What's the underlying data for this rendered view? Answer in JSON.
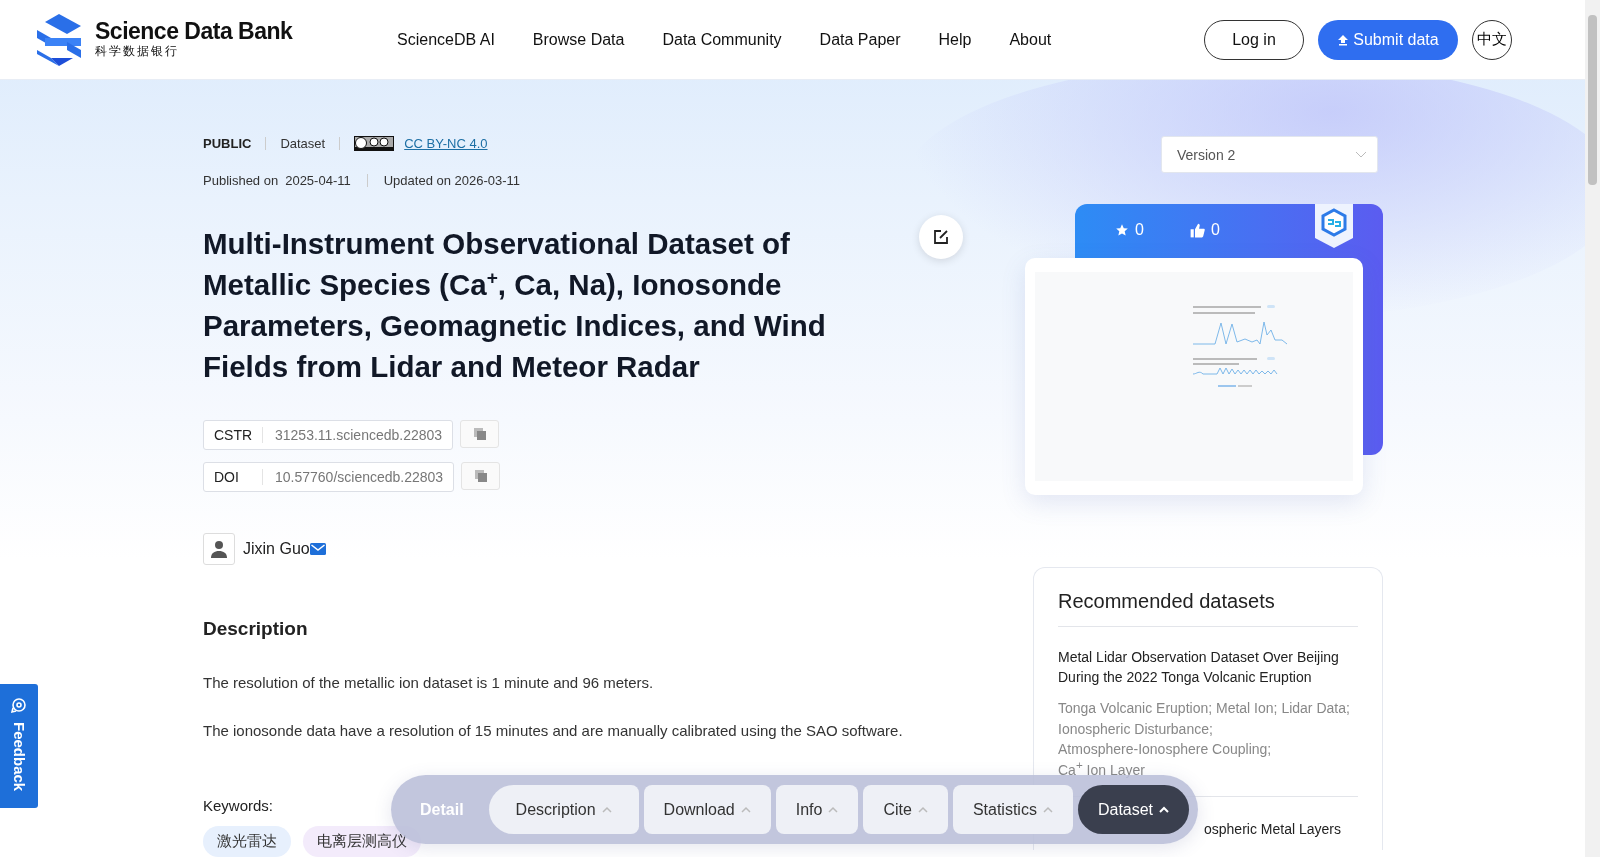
{
  "header": {
    "logo": {
      "title": "Science Data Bank",
      "subtitle": "科学数据银行"
    },
    "nav": [
      "ScienceDB AI",
      "Browse Data",
      "Data Community",
      "Data Paper",
      "Help",
      "About"
    ],
    "login": "Log in",
    "submit": "Submit data",
    "language": "中文"
  },
  "meta": {
    "access": "PUBLIC",
    "type": "Dataset",
    "license": "CC BY-NC 4.0",
    "published_label": "Published on",
    "published": "2025-04-11",
    "updated": "Updated on 2026-03-11"
  },
  "title": "Multi-Instrument Observational Dataset of Metallic Species (Ca$^{+}$, Ca, Na), Ionosonde Parameters, Geomagnetic Indices, and Wind Fields from Lidar and Meteor Radar",
  "identifiers": [
    {
      "label": "CSTR",
      "value": "31253.11.sciencedb.22803"
    },
    {
      "label": "DOI",
      "value": "10.57760/sciencedb.22803"
    }
  ],
  "author": {
    "name": "Jixin Guo"
  },
  "description": {
    "heading": "Description",
    "paragraphs": [
      "The resolution of the metallic ion dataset is 1 minute and 96 meters.",
      "The ionosonde data have a resolution of 15 minutes and are manually calibrated using the SAO software."
    ]
  },
  "keywords": {
    "label": "Keywords:",
    "items": [
      {
        "text": "激光雷达",
        "color": "#e7f0fd"
      },
      {
        "text": "电离层测高仪",
        "color": "#f3ebfb"
      }
    ]
  },
  "version": "Version 2",
  "stats": {
    "favorites": "0",
    "likes": "0"
  },
  "recommended": {
    "heading": "Recommended datasets",
    "items": [
      {
        "title": "Metal Lidar Observation Dataset Over Beijing During the 2022 Tonga Volcanic Eruption",
        "keywords": [
          "Tonga Volcanic Eruption;",
          "Metal Ion;",
          "Lidar Data;",
          "Ionospheric Disturbance;",
          "Atmosphere-Ionosphere Coupling;",
          "Ca$^{+}$ Ion Layer"
        ]
      },
      {
        "title": "ospheric Metal Layers"
      }
    ]
  },
  "section_nav": {
    "label": "Detail",
    "tabs": [
      {
        "label": "Description",
        "selected": false
      },
      {
        "label": "Download",
        "selected": false
      },
      {
        "label": "Info",
        "selected": false
      },
      {
        "label": "Cite",
        "selected": false
      },
      {
        "label": "Statistics",
        "selected": false
      },
      {
        "label": "Dataset",
        "selected": true
      }
    ]
  },
  "feedback": "Feedback"
}
